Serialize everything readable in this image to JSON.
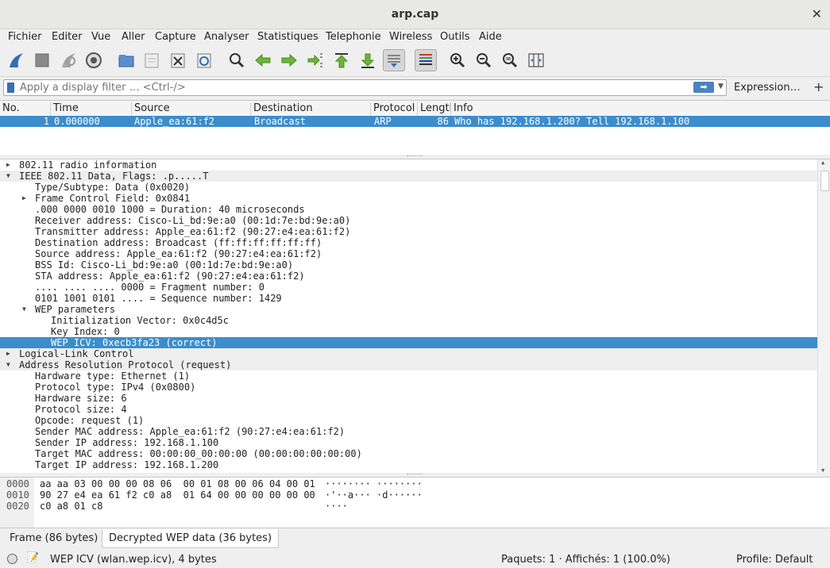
{
  "window": {
    "title": "arp.cap",
    "close_glyph": "✕"
  },
  "menu": [
    "Fichier",
    "Editer",
    "Vue",
    "Aller",
    "Capture",
    "Analyser",
    "Statistiques",
    "Telephonie",
    "Wireless",
    "Outils",
    "Aide"
  ],
  "toolbar": {
    "icons": [
      "shark-fin-start-icon",
      "stop-capture-icon",
      "restart-capture-icon",
      "capture-options-icon",
      "open-file-icon",
      "save-file-icon",
      "close-file-icon",
      "reload-file-icon",
      "find-packet-icon",
      "go-back-icon",
      "go-forward-icon",
      "go-to-packet-icon",
      "go-first-icon",
      "go-last-icon",
      "autoscroll-icon",
      "colorize-icon",
      "zoom-in-icon",
      "zoom-out-icon",
      "zoom-normal-icon",
      "resize-columns-icon"
    ]
  },
  "filter": {
    "placeholder": "Apply a display filter … <Ctrl-/>",
    "expression_label": "Expression…",
    "plus": "+"
  },
  "packet_list": {
    "columns": [
      "No.",
      "Time",
      "Source",
      "Destination",
      "Protocol",
      "Length",
      "Info"
    ],
    "rows": [
      {
        "no": "1",
        "time": "0.000000",
        "source": "Apple_ea:61:f2",
        "destination": "Broadcast",
        "protocol": "ARP",
        "length": "86",
        "info": "Who has 192.168.1.200? Tell 192.168.1.100"
      }
    ]
  },
  "details": [
    {
      "text": "802.11 radio information",
      "indent": 0,
      "expander": "collapsed",
      "style": "normal"
    },
    {
      "text": "IEEE 802.11 Data, Flags: .p.....T",
      "indent": 0,
      "expander": "expanded",
      "style": "hdr"
    },
    {
      "text": "Type/Subtype: Data (0x0020)",
      "indent": 1,
      "expander": "none",
      "style": "normal"
    },
    {
      "text": "Frame Control Field: 0x0841",
      "indent": 1,
      "expander": "collapsed",
      "style": "normal"
    },
    {
      "text": ".000 0000 0010 1000 = Duration: 40 microseconds",
      "indent": 1,
      "expander": "none",
      "style": "normal"
    },
    {
      "text": "Receiver address: Cisco-Li_bd:9e:a0 (00:1d:7e:bd:9e:a0)",
      "indent": 1,
      "expander": "none",
      "style": "normal"
    },
    {
      "text": "Transmitter address: Apple_ea:61:f2 (90:27:e4:ea:61:f2)",
      "indent": 1,
      "expander": "none",
      "style": "normal"
    },
    {
      "text": "Destination address: Broadcast (ff:ff:ff:ff:ff:ff)",
      "indent": 1,
      "expander": "none",
      "style": "normal"
    },
    {
      "text": "Source address: Apple_ea:61:f2 (90:27:e4:ea:61:f2)",
      "indent": 1,
      "expander": "none",
      "style": "normal"
    },
    {
      "text": "BSS Id: Cisco-Li_bd:9e:a0 (00:1d:7e:bd:9e:a0)",
      "indent": 1,
      "expander": "none",
      "style": "normal"
    },
    {
      "text": "STA address: Apple_ea:61:f2 (90:27:e4:ea:61:f2)",
      "indent": 1,
      "expander": "none",
      "style": "normal"
    },
    {
      "text": ".... .... .... 0000 = Fragment number: 0",
      "indent": 1,
      "expander": "none",
      "style": "normal"
    },
    {
      "text": "0101 1001 0101 .... = Sequence number: 1429",
      "indent": 1,
      "expander": "none",
      "style": "normal"
    },
    {
      "text": "WEP parameters",
      "indent": 1,
      "expander": "expanded",
      "style": "normal"
    },
    {
      "text": "Initialization Vector: 0x0c4d5c",
      "indent": 2,
      "expander": "none",
      "style": "normal"
    },
    {
      "text": "Key Index: 0",
      "indent": 2,
      "expander": "none",
      "style": "normal"
    },
    {
      "text": "WEP ICV: 0xecb3fa23 (correct)",
      "indent": 2,
      "expander": "none",
      "style": "sel"
    },
    {
      "text": "Logical-Link Control",
      "indent": 0,
      "expander": "collapsed",
      "style": "hdr"
    },
    {
      "text": "Address Resolution Protocol (request)",
      "indent": 0,
      "expander": "expanded",
      "style": "hdr"
    },
    {
      "text": "Hardware type: Ethernet (1)",
      "indent": 1,
      "expander": "none",
      "style": "normal"
    },
    {
      "text": "Protocol type: IPv4 (0x0800)",
      "indent": 1,
      "expander": "none",
      "style": "normal"
    },
    {
      "text": "Hardware size: 6",
      "indent": 1,
      "expander": "none",
      "style": "normal"
    },
    {
      "text": "Protocol size: 4",
      "indent": 1,
      "expander": "none",
      "style": "normal"
    },
    {
      "text": "Opcode: request (1)",
      "indent": 1,
      "expander": "none",
      "style": "normal"
    },
    {
      "text": "Sender MAC address: Apple_ea:61:f2 (90:27:e4:ea:61:f2)",
      "indent": 1,
      "expander": "none",
      "style": "normal"
    },
    {
      "text": "Sender IP address: 192.168.1.100",
      "indent": 1,
      "expander": "none",
      "style": "normal"
    },
    {
      "text": "Target MAC address: 00:00:00_00:00:00 (00:00:00:00:00:00)",
      "indent": 1,
      "expander": "none",
      "style": "normal"
    },
    {
      "text": "Target IP address: 192.168.1.200",
      "indent": 1,
      "expander": "none",
      "style": "normal"
    }
  ],
  "bytes": [
    {
      "offset": "0000",
      "hex": "aa aa 03 00 00 00 08 06  00 01 08 00 06 04 00 01",
      "ascii": "········ ········"
    },
    {
      "offset": "0010",
      "hex": "90 27 e4 ea 61 f2 c0 a8  01 64 00 00 00 00 00 00",
      "ascii": "·'··a··· ·d······"
    },
    {
      "offset": "0020",
      "hex": "c0 a8 01 c8",
      "ascii": "····"
    }
  ],
  "byte_tabs": [
    "Frame (86 bytes)",
    "Decrypted WEP data (36 bytes)"
  ],
  "status": {
    "field_info": "WEP ICV (wlan.wep.icv), 4 bytes",
    "packets": "Paquets: 1 · Affichés: 1 (100.0%)",
    "profile": "Profile: Default"
  }
}
